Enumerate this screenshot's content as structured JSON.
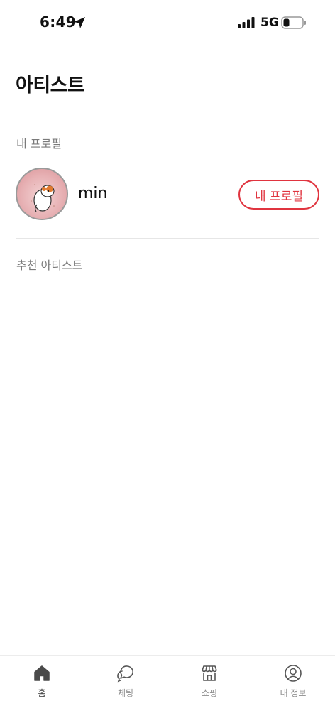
{
  "status_bar": {
    "time": "6:49",
    "network": "5G",
    "icons": [
      "location-arrow-icon",
      "signal-icon",
      "battery-icon"
    ]
  },
  "header": {
    "title": "아티스트"
  },
  "my_profile": {
    "section_label": "내 프로필",
    "username": "min",
    "button_label": "내 프로필",
    "avatar": "hamster-avatar"
  },
  "recommended": {
    "section_label": "추천 아티스트",
    "items": []
  },
  "tab_bar": {
    "tabs": [
      {
        "label": "홈",
        "icon": "home-icon",
        "active": true
      },
      {
        "label": "체팅",
        "icon": "chat-icon",
        "active": false
      },
      {
        "label": "쇼핑",
        "icon": "store-icon",
        "active": false
      },
      {
        "label": "내 정보",
        "icon": "user-circle-icon",
        "active": false
      }
    ]
  },
  "colors": {
    "accent": "#e0343f",
    "muted_text": "#7a7a7a",
    "active_icon": "#4a4a4a"
  }
}
